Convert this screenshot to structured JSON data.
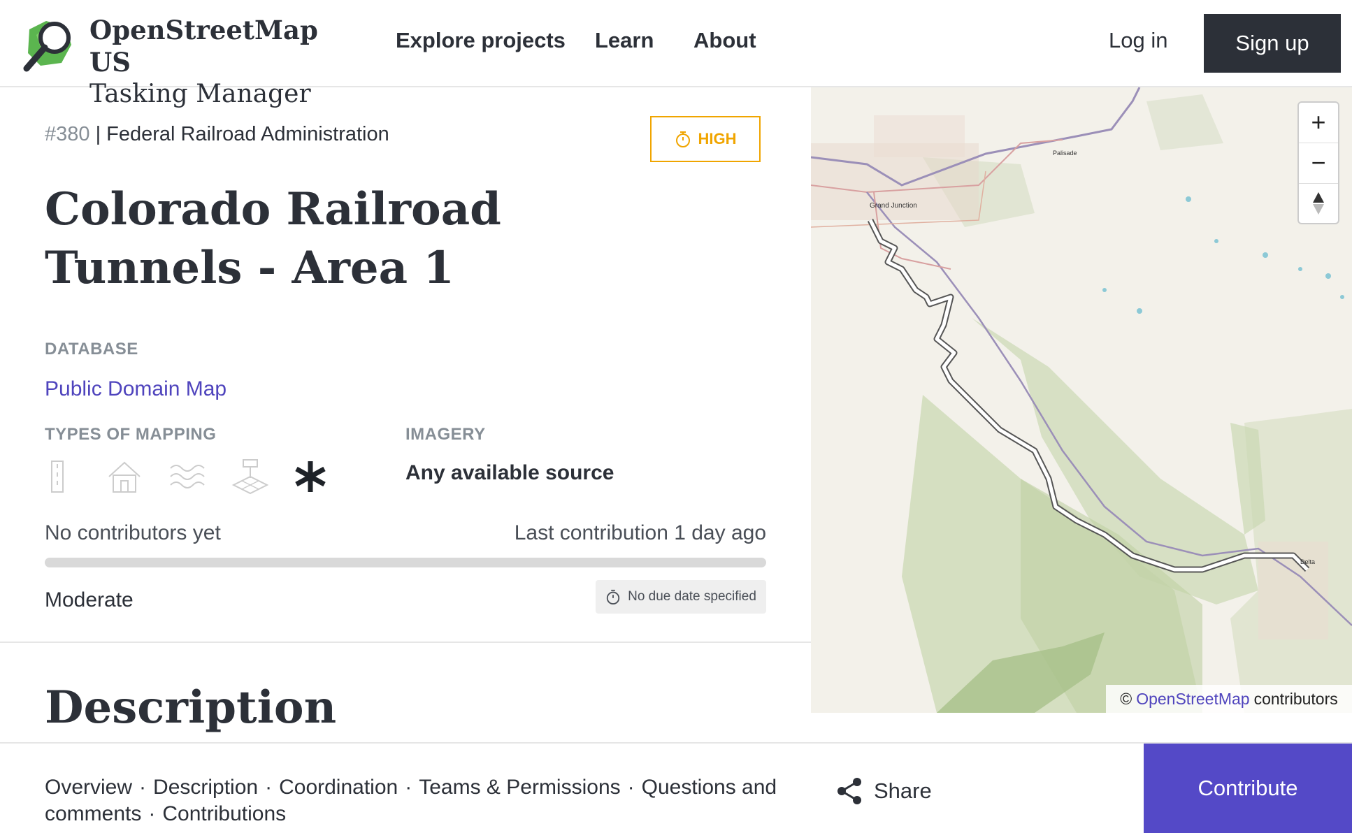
{
  "header": {
    "logo_line1": "OpenStreetMap US",
    "logo_line2": "Tasking Manager",
    "nav": [
      "Explore projects",
      "Learn",
      "About"
    ],
    "login": "Log in",
    "signup": "Sign up"
  },
  "project": {
    "id": "#380",
    "separator": " | ",
    "organisation": "Federal Railroad Administration",
    "priority": "HIGH",
    "title": "Colorado Railroad Tunnels - Area 1",
    "database_label": "DATABASE",
    "database_value": "Public Domain Map",
    "mapping_types_label": "TYPES OF MAPPING",
    "mapping_types": [
      {
        "icon": "roads-icon",
        "active": false
      },
      {
        "icon": "buildings-icon",
        "active": false
      },
      {
        "icon": "waterways-icon",
        "active": false
      },
      {
        "icon": "land-use-icon",
        "active": false
      },
      {
        "icon": "other-asterisk-icon",
        "active": true
      }
    ],
    "imagery_label": "IMAGERY",
    "imagery_value": "Any available source",
    "contributors": "No contributors yet",
    "last_contribution": "Last contribution 1 day ago",
    "progress_percent": 0,
    "difficulty": "Moderate",
    "due_date": "No due date specified",
    "description_heading": "Description"
  },
  "map": {
    "labels": [
      "Grand Junction",
      "Palisade",
      "Delta"
    ],
    "zoom_in": "+",
    "zoom_out": "−",
    "attribution_prefix": "©",
    "attribution_link": "OpenStreetMap",
    "attribution_suffix": "contributors"
  },
  "bottom": {
    "links": [
      "Overview",
      "Description",
      "Coordination",
      "Teams & Permissions",
      "Questions and comments",
      "Contributions"
    ],
    "share": "Share",
    "contribute": "Contribute"
  },
  "colors": {
    "accent": "#4f44bd",
    "priority_high": "#f0a500",
    "dark": "#2c3038",
    "muted": "#868e96"
  }
}
